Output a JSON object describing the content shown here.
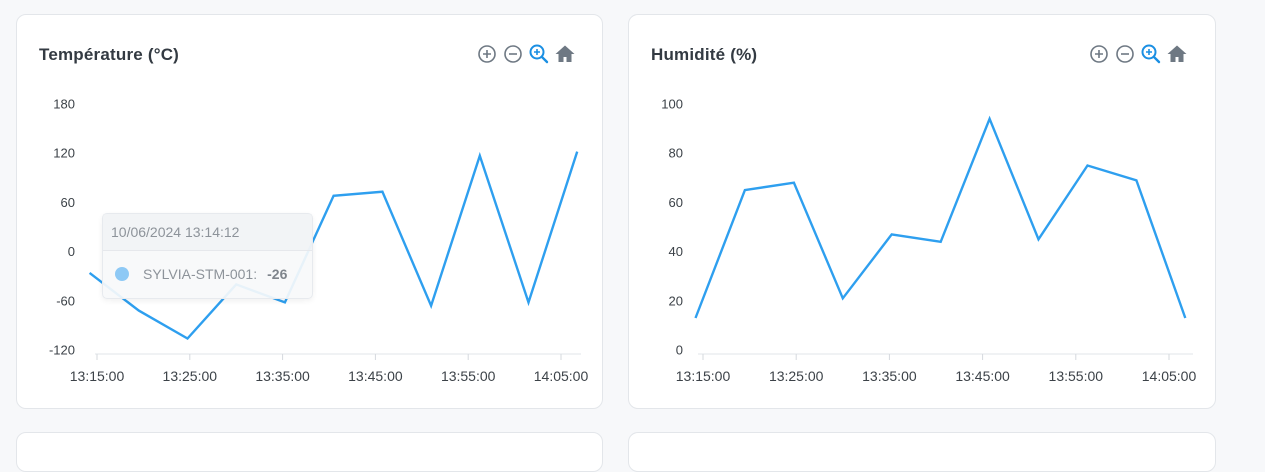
{
  "colors": {
    "line": "#2e9fef",
    "accent": "#1a8fe3",
    "toolbar_icon": "#6e7883"
  },
  "toolbar": {
    "icons": [
      "zoom-in-icon",
      "zoom-out-icon",
      "selection-zoom-icon",
      "home-icon"
    ]
  },
  "charts": [
    {
      "title": "Température (°C)",
      "tooltip": {
        "time": "10/06/2024 13:14:12",
        "series": "SYLVIA-STM-001:",
        "value": "-26"
      }
    },
    {
      "title": "Humidité (%)"
    }
  ],
  "chart_data": [
    {
      "type": "line",
      "title": "Température (°C)",
      "x_tick_labels": [
        "13:15:00",
        "13:25:00",
        "13:35:00",
        "13:45:00",
        "13:55:00",
        "14:05:00"
      ],
      "y_tick_labels": [
        "180",
        "120",
        "60",
        "0",
        "-60",
        "-120"
      ],
      "ylim": [
        -120,
        180
      ],
      "grid": false,
      "x": [
        "13:14:12",
        "13:19:30",
        "13:24:45",
        "13:30:00",
        "13:35:15",
        "13:40:30",
        "13:45:45",
        "13:51:00",
        "13:56:15",
        "14:01:30",
        "14:06:45"
      ],
      "series": [
        {
          "values": [
            -26,
            -72,
            -106,
            -40,
            -62,
            68,
            73,
            -66,
            117,
            -62,
            122
          ]
        }
      ]
    },
    {
      "type": "line",
      "title": "Humidité (%)",
      "x_tick_labels": [
        "13:15:00",
        "13:25:00",
        "13:35:00",
        "13:45:00",
        "13:55:00",
        "14:05:00"
      ],
      "y_tick_labels": [
        "100",
        "80",
        "60",
        "40",
        "20",
        "0"
      ],
      "ylim": [
        0,
        100
      ],
      "grid": false,
      "x": [
        "13:14:12",
        "13:19:30",
        "13:24:45",
        "13:30:00",
        "13:35:15",
        "13:40:30",
        "13:45:45",
        "13:51:00",
        "13:56:15",
        "14:01:30",
        "14:06:45"
      ],
      "series": [
        {
          "values": [
            13,
            65,
            68,
            21,
            47,
            44,
            94,
            45,
            75,
            69,
            13
          ]
        }
      ]
    }
  ]
}
